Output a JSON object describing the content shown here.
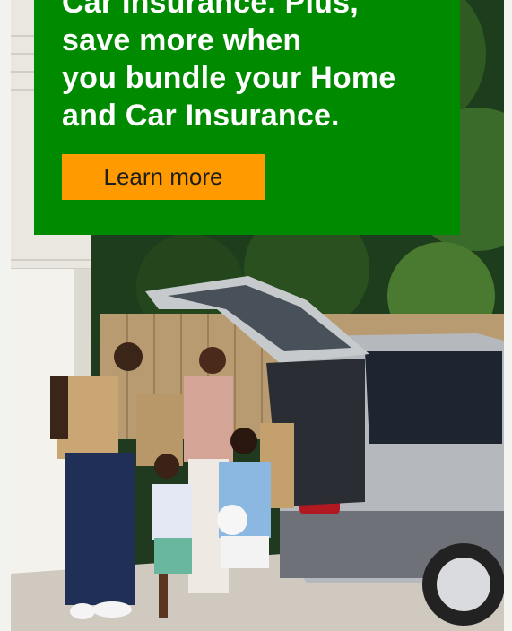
{
  "ad": {
    "headline_lines": [
      "Car Insurance. Plus,",
      "save more when",
      "you bundle your Home",
      "and Car Insurance."
    ],
    "cta_label": "Learn more"
  },
  "colors": {
    "promo_green": "#008a00",
    "cta_orange": "#ff9a00",
    "headline_text": "#ffffff",
    "cta_text": "#1d1d1d"
  },
  "photo": {
    "subject": "family unloading groceries from a silver minivan in a driveway"
  }
}
